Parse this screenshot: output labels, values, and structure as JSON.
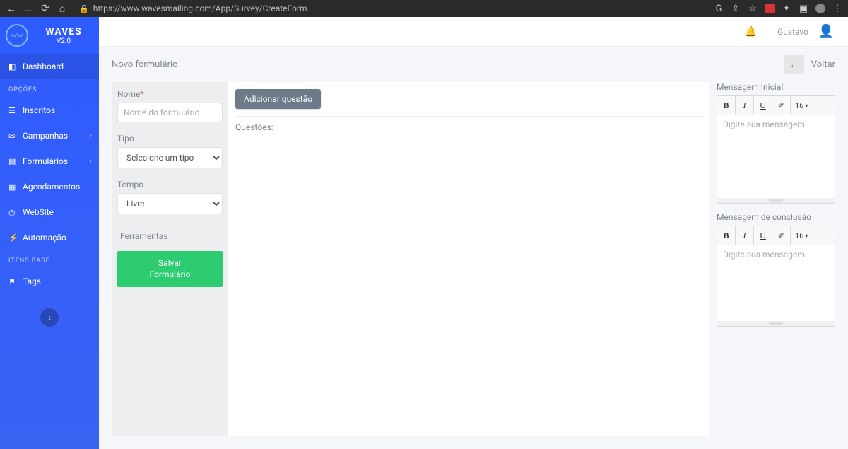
{
  "browser": {
    "url": "https://www.wavesmailing.com/App/Survey/CreateForm"
  },
  "brand": {
    "name": "WAVES",
    "version": "V2.0"
  },
  "sidebar": {
    "items": {
      "dashboard": "Dashboard",
      "inscritos": "Inscritos",
      "campanhas": "Campanhas",
      "formularios": "Formulários",
      "agendamentos": "Agendamentos",
      "website": "WebSite",
      "automacao": "Automação",
      "tags": "Tags"
    },
    "headers": {
      "opcoes": "OPÇÕES",
      "itensbase": "ITENS BASE"
    }
  },
  "header": {
    "username": "Gustavo"
  },
  "page": {
    "title": "Novo formulário",
    "backLabel": "Voltar"
  },
  "form": {
    "nameLabel": "Nome",
    "namePlaceholder": "Nome do formulário",
    "typeLabel": "Tipo",
    "typePlaceholder": "Selecione um tipo",
    "timeLabel": "Tempo",
    "timeValue": "Livre",
    "toolsLabel": "Ferramentas",
    "saveLine1": "Salvar",
    "saveLine2": "Formulário"
  },
  "questions": {
    "addBtn": "Adicionar questão",
    "label": "Questões:"
  },
  "messages": {
    "initial": {
      "title": "Mensagem Inicial",
      "placeholder": "Digite sua mensagem",
      "fontSize": "16"
    },
    "conclusion": {
      "title": "Mensagem de conclusão",
      "placeholder": "Digite sua mensagem",
      "fontSize": "16"
    }
  },
  "toolbar": {
    "bold": "B",
    "italic": "I",
    "underline": "U"
  }
}
